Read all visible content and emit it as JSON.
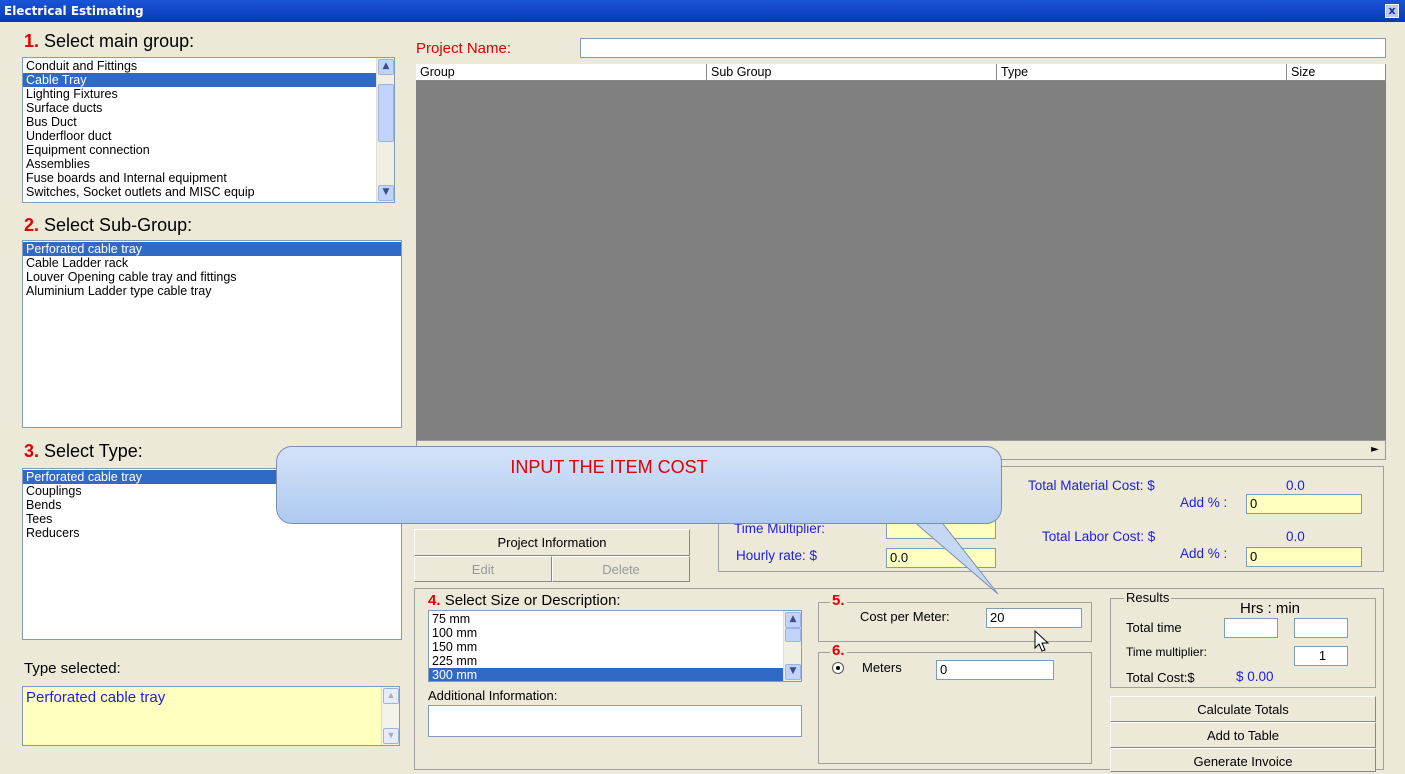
{
  "window": {
    "title": "Electrical Estimating",
    "close_label": "x"
  },
  "step1": {
    "num": "1.",
    "label": "Select main group:",
    "items": [
      "Conduit and Fittings",
      "Cable Tray",
      "Lighting Fixtures",
      "Surface ducts",
      "Bus Duct",
      "Underfloor duct",
      "Equipment connection",
      "Assemblies",
      "Fuse boards and Internal equipment",
      "Switches, Socket outlets and MISC equip"
    ],
    "selected_index": 1
  },
  "step2": {
    "num": "2.",
    "label": "Select Sub-Group:",
    "items": [
      "Perforated cable tray",
      "Cable Ladder rack",
      "Louver Opening cable tray and fittings",
      "Aluminium Ladder type cable tray"
    ],
    "selected_index": 0
  },
  "step3": {
    "num": "3.",
    "label": "Select Type:",
    "items": [
      "Perforated cable tray",
      "Couplings",
      "Bends",
      "Tees",
      "Reducers"
    ],
    "selected_index": 0
  },
  "type_selected": {
    "label": "Type selected:",
    "value": "Perforated cable tray"
  },
  "project": {
    "label": "Project Name:",
    "value": ""
  },
  "table": {
    "columns": [
      "Group",
      "Sub Group",
      "Type",
      "Size"
    ]
  },
  "callout": {
    "text": "INPUT THE ITEM COST"
  },
  "buttons": {
    "project_info": "Project Information",
    "edit": "Edit",
    "delete": "Delete",
    "calculate": "Calculate Totals",
    "add": "Add to Table",
    "invoice": "Generate Invoice"
  },
  "rates": {
    "time_mult_label": "Time Multiplier:",
    "time_mult_value": "",
    "hourly_label": "Hourly rate: $",
    "hourly_value": "0.0"
  },
  "totals": {
    "material_label": "Total Material Cost: $",
    "material_value": "0.0",
    "material_add_label": "Add % :",
    "material_add_value": "0",
    "labor_label": "Total Labor Cost: $",
    "labor_value": "0.0",
    "labor_add_label": "Add % :",
    "labor_add_value": "0"
  },
  "step4": {
    "num": "4.",
    "label": "Select Size or Description:",
    "items": [
      "75 mm",
      "100 mm",
      "150 mm",
      "225 mm",
      "300 mm"
    ],
    "selected_index": 4,
    "additional_label": "Additional Information:",
    "additional_value": ""
  },
  "step5": {
    "num": "5.",
    "label": "Cost per Meter:",
    "value": "20"
  },
  "step6": {
    "num": "6.",
    "label": "Meters",
    "value": "0"
  },
  "results": {
    "title": "Results",
    "hrs_min": "Hrs : min",
    "total_time_label": "Total time",
    "hours": "",
    "minutes": "",
    "time_mult_label": "Time multiplier:",
    "time_mult_value": "1",
    "total_cost_label": "Total Cost:$",
    "total_cost_value": "$ 0.00"
  }
}
